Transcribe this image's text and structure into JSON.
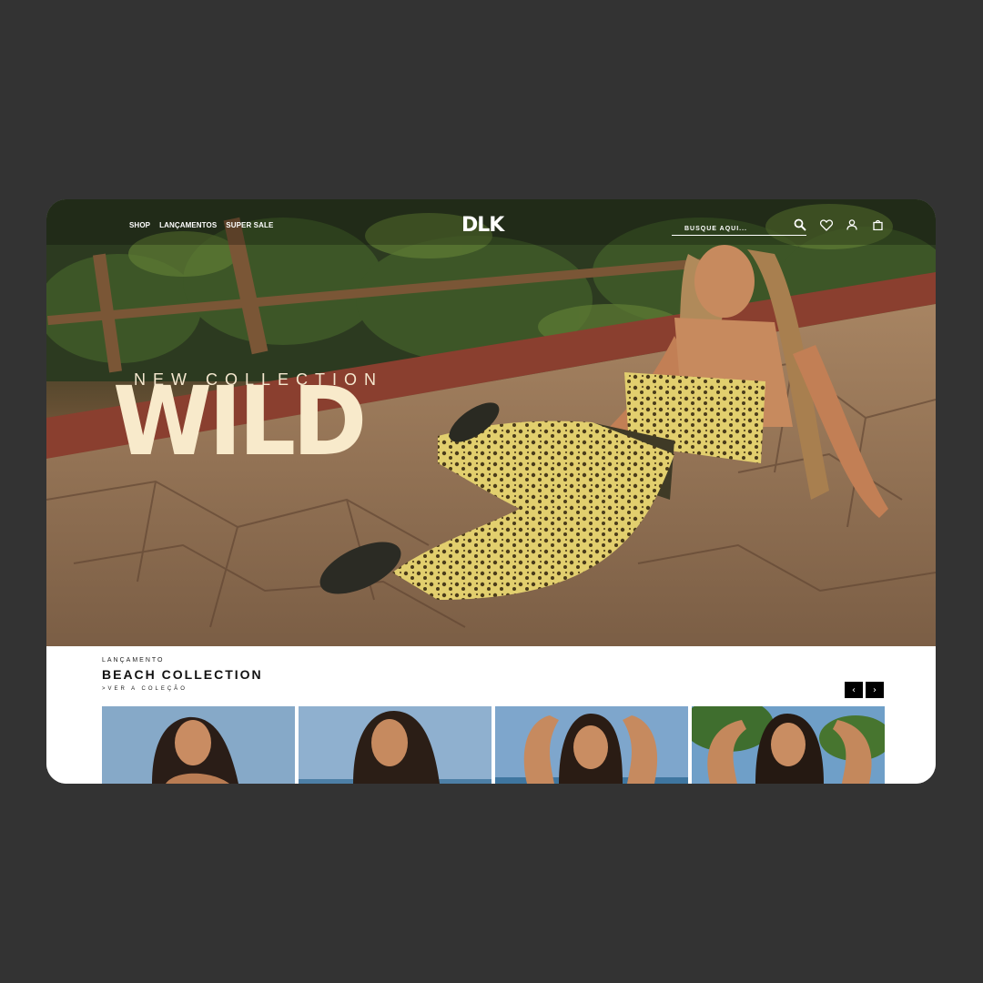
{
  "header": {
    "nav": [
      "SHOP",
      "LANÇAMENTOS",
      "SUPER SALE"
    ],
    "logo": "DLK",
    "search_placeholder": "BUSQUE AQUI..."
  },
  "icons": {
    "search": "search-icon",
    "wishlist": "heart-icon",
    "account": "user-icon",
    "cart": "bag-icon"
  },
  "hero": {
    "kicker": "NEW COLLECTION",
    "title": "WILD"
  },
  "collection": {
    "kicker": "LANÇAMENTO",
    "title": "BEACH COLLECTION",
    "link": ">VER A COLEÇÃO",
    "prev": "‹",
    "next": "›",
    "cards": 4
  },
  "colors": {
    "page_bg": "#333333",
    "hero_text": "#f8eacb",
    "arrow_bg": "#000000"
  }
}
